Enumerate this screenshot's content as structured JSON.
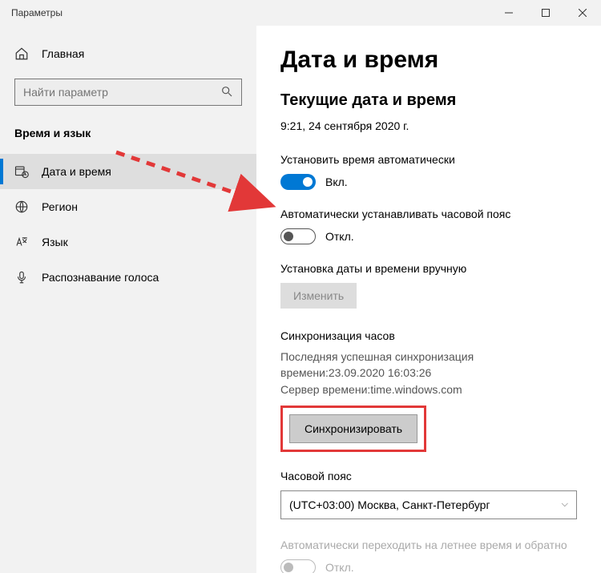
{
  "titlebar": {
    "title": "Параметры"
  },
  "sidebar": {
    "home": "Главная",
    "search_placeholder": "Найти параметр",
    "section": "Время и язык",
    "items": [
      {
        "label": "Дата и время"
      },
      {
        "label": "Регион"
      },
      {
        "label": "Язык"
      },
      {
        "label": "Распознавание голоса"
      }
    ]
  },
  "main": {
    "h1": "Дата и время",
    "h2": "Текущие дата и время",
    "current": "9:21, 24 сентября 2020 г.",
    "auto_time_label": "Установить время автоматически",
    "auto_time_state": "Вкл.",
    "auto_tz_label": "Автоматически устанавливать часовой пояс",
    "auto_tz_state": "Откл.",
    "manual_label": "Установка даты и времени вручную",
    "manual_button": "Изменить",
    "sync_h": "Синхронизация часов",
    "sync_line1": "Последняя успешная синхронизация времени:23.09.2020 16:03:26",
    "sync_line2": "Сервер времени:time.windows.com",
    "sync_button": "Синхронизировать",
    "tz_h": "Часовой пояс",
    "tz_value": "(UTC+03:00) Москва, Санкт-Петербург",
    "dst_label": "Автоматически переходить на летнее время и обратно",
    "dst_state": "Откл."
  }
}
